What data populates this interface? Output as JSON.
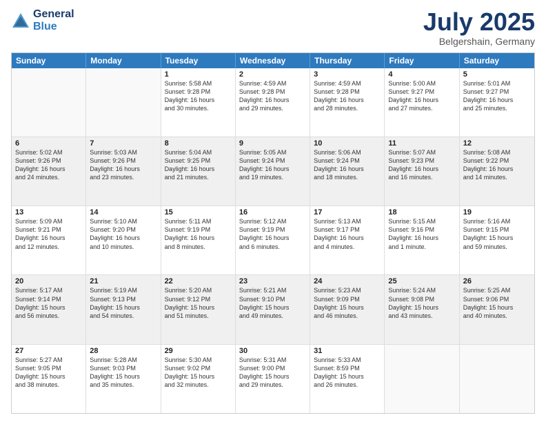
{
  "header": {
    "logo_general": "General",
    "logo_blue": "Blue",
    "month_title": "July 2025",
    "location": "Belgershain, Germany"
  },
  "days_of_week": [
    "Sunday",
    "Monday",
    "Tuesday",
    "Wednesday",
    "Thursday",
    "Friday",
    "Saturday"
  ],
  "weeks": [
    [
      {
        "day": "",
        "empty": true
      },
      {
        "day": "",
        "empty": true
      },
      {
        "day": "1",
        "sunrise": "5:58 AM",
        "sunset": "9:28 PM",
        "daylight": "Daylight: 16 hours\nand 30 minutes."
      },
      {
        "day": "2",
        "sunrise": "4:59 AM",
        "sunset": "9:28 PM",
        "daylight": "Daylight: 16 hours\nand 29 minutes."
      },
      {
        "day": "3",
        "sunrise": "4:59 AM",
        "sunset": "9:28 PM",
        "daylight": "Daylight: 16 hours\nand 28 minutes."
      },
      {
        "day": "4",
        "sunrise": "5:00 AM",
        "sunset": "9:27 PM",
        "daylight": "Daylight: 16 hours\nand 27 minutes."
      },
      {
        "day": "5",
        "sunrise": "5:01 AM",
        "sunset": "9:27 PM",
        "daylight": "Daylight: 16 hours\nand 25 minutes."
      }
    ],
    [
      {
        "day": "6",
        "sunrise": "5:02 AM",
        "sunset": "9:26 PM",
        "daylight": "Daylight: 16 hours\nand 24 minutes."
      },
      {
        "day": "7",
        "sunrise": "5:03 AM",
        "sunset": "9:26 PM",
        "daylight": "Daylight: 16 hours\nand 23 minutes."
      },
      {
        "day": "8",
        "sunrise": "5:04 AM",
        "sunset": "9:25 PM",
        "daylight": "Daylight: 16 hours\nand 21 minutes."
      },
      {
        "day": "9",
        "sunrise": "5:05 AM",
        "sunset": "9:24 PM",
        "daylight": "Daylight: 16 hours\nand 19 minutes."
      },
      {
        "day": "10",
        "sunrise": "5:06 AM",
        "sunset": "9:24 PM",
        "daylight": "Daylight: 16 hours\nand 18 minutes."
      },
      {
        "day": "11",
        "sunrise": "5:07 AM",
        "sunset": "9:23 PM",
        "daylight": "Daylight: 16 hours\nand 16 minutes."
      },
      {
        "day": "12",
        "sunrise": "5:08 AM",
        "sunset": "9:22 PM",
        "daylight": "Daylight: 16 hours\nand 14 minutes."
      }
    ],
    [
      {
        "day": "13",
        "sunrise": "5:09 AM",
        "sunset": "9:21 PM",
        "daylight": "Daylight: 16 hours\nand 12 minutes."
      },
      {
        "day": "14",
        "sunrise": "5:10 AM",
        "sunset": "9:20 PM",
        "daylight": "Daylight: 16 hours\nand 10 minutes."
      },
      {
        "day": "15",
        "sunrise": "5:11 AM",
        "sunset": "9:19 PM",
        "daylight": "Daylight: 16 hours\nand 8 minutes."
      },
      {
        "day": "16",
        "sunrise": "5:12 AM",
        "sunset": "9:19 PM",
        "daylight": "Daylight: 16 hours\nand 6 minutes."
      },
      {
        "day": "17",
        "sunrise": "5:13 AM",
        "sunset": "9:17 PM",
        "daylight": "Daylight: 16 hours\nand 4 minutes."
      },
      {
        "day": "18",
        "sunrise": "5:15 AM",
        "sunset": "9:16 PM",
        "daylight": "Daylight: 16 hours\nand 1 minute."
      },
      {
        "day": "19",
        "sunrise": "5:16 AM",
        "sunset": "9:15 PM",
        "daylight": "Daylight: 15 hours\nand 59 minutes."
      }
    ],
    [
      {
        "day": "20",
        "sunrise": "5:17 AM",
        "sunset": "9:14 PM",
        "daylight": "Daylight: 15 hours\nand 56 minutes."
      },
      {
        "day": "21",
        "sunrise": "5:19 AM",
        "sunset": "9:13 PM",
        "daylight": "Daylight: 15 hours\nand 54 minutes."
      },
      {
        "day": "22",
        "sunrise": "5:20 AM",
        "sunset": "9:12 PM",
        "daylight": "Daylight: 15 hours\nand 51 minutes."
      },
      {
        "day": "23",
        "sunrise": "5:21 AM",
        "sunset": "9:10 PM",
        "daylight": "Daylight: 15 hours\nand 49 minutes."
      },
      {
        "day": "24",
        "sunrise": "5:23 AM",
        "sunset": "9:09 PM",
        "daylight": "Daylight: 15 hours\nand 46 minutes."
      },
      {
        "day": "25",
        "sunrise": "5:24 AM",
        "sunset": "9:08 PM",
        "daylight": "Daylight: 15 hours\nand 43 minutes."
      },
      {
        "day": "26",
        "sunrise": "5:25 AM",
        "sunset": "9:06 PM",
        "daylight": "Daylight: 15 hours\nand 40 minutes."
      }
    ],
    [
      {
        "day": "27",
        "sunrise": "5:27 AM",
        "sunset": "9:05 PM",
        "daylight": "Daylight: 15 hours\nand 38 minutes."
      },
      {
        "day": "28",
        "sunrise": "5:28 AM",
        "sunset": "9:03 PM",
        "daylight": "Daylight: 15 hours\nand 35 minutes."
      },
      {
        "day": "29",
        "sunrise": "5:30 AM",
        "sunset": "9:02 PM",
        "daylight": "Daylight: 15 hours\nand 32 minutes."
      },
      {
        "day": "30",
        "sunrise": "5:31 AM",
        "sunset": "9:00 PM",
        "daylight": "Daylight: 15 hours\nand 29 minutes."
      },
      {
        "day": "31",
        "sunrise": "5:33 AM",
        "sunset": "8:59 PM",
        "daylight": "Daylight: 15 hours\nand 26 minutes."
      },
      {
        "day": "",
        "empty": true
      },
      {
        "day": "",
        "empty": true
      }
    ]
  ]
}
